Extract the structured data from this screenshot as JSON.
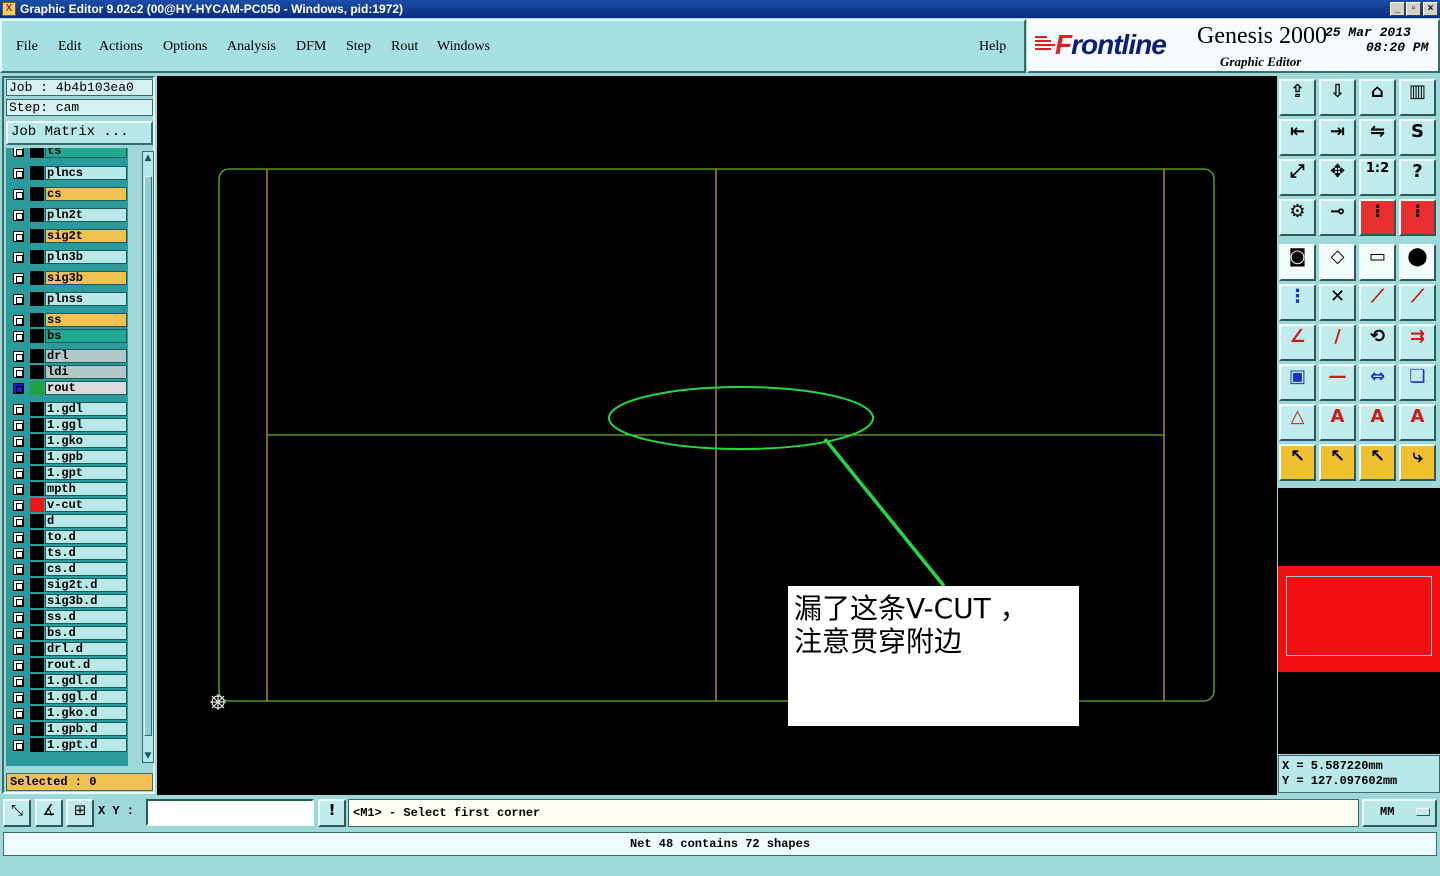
{
  "window": {
    "title": "Graphic Editor 9.02c2 (00@HY-HYCAM-PC050 - Windows, pid:1972)",
    "app_icon_label": "X",
    "controls": {
      "minimize": "_",
      "restore": "▫",
      "close": "×"
    }
  },
  "menu": {
    "items": [
      "File",
      "Edit",
      "Actions",
      "Options",
      "Analysis",
      "DFM",
      "Step",
      "Rout",
      "Windows"
    ],
    "help": "Help"
  },
  "logo": {
    "brand_initial": "F",
    "brand_rest": "rontline",
    "product": "Genesis 2000",
    "subtitle": "Graphic Editor",
    "date": "25 Mar 2013",
    "time": "08:20 PM"
  },
  "job": {
    "job_label": "Job : 4b4b103ea0",
    "step_label": "Step: cam",
    "job_matrix_button": "Job Matrix ...",
    "selected_label": "Selected : 0"
  },
  "layers": [
    {
      "name": "ts",
      "bg": "#20a890",
      "swatch": "#000000"
    },
    {
      "name": "plncs",
      "bg": "#b8e8e8",
      "swatch": "#000000"
    },
    {
      "name": "cs",
      "bg": "#f0c050",
      "swatch": "#000000"
    },
    {
      "name": "pln2t",
      "bg": "#b8e8e8",
      "swatch": "#000000"
    },
    {
      "name": "sig2t",
      "bg": "#f0c050",
      "swatch": "#000000"
    },
    {
      "name": "pln3b",
      "bg": "#b8e8e8",
      "swatch": "#000000"
    },
    {
      "name": "sig3b",
      "bg": "#f0c050",
      "swatch": "#000000"
    },
    {
      "name": "plnss",
      "bg": "#b8e8e8",
      "swatch": "#000000"
    },
    {
      "name": "ss",
      "bg": "#f0c050",
      "swatch": "#000000"
    },
    {
      "name": "bs",
      "bg": "#20a890",
      "swatch": "#000000"
    },
    {
      "name": "drl",
      "bg": "#b0c8c8",
      "swatch": "#000000"
    },
    {
      "name": "ldi",
      "bg": "#b0c8c8",
      "swatch": "#000000"
    },
    {
      "name": "rout",
      "bg": "#dcdcdc",
      "swatch": "#20a040",
      "active": true
    },
    {
      "name": "1.gdl",
      "bg": "#b8e8e8",
      "swatch": "#000000"
    },
    {
      "name": "1.ggl",
      "bg": "#b8e8e8",
      "swatch": "#000000"
    },
    {
      "name": "1.gko",
      "bg": "#b8e8e8",
      "swatch": "#000000"
    },
    {
      "name": "1.gpb",
      "bg": "#b8e8e8",
      "swatch": "#000000"
    },
    {
      "name": "1.gpt",
      "bg": "#b8e8e8",
      "swatch": "#000000"
    },
    {
      "name": "mpth",
      "bg": "#b8e8e8",
      "swatch": "#000000"
    },
    {
      "name": "v-cut",
      "bg": "#b8e8e8",
      "swatch": "#e81818"
    },
    {
      "name": "d",
      "bg": "#b8e8e8",
      "swatch": "#000000"
    },
    {
      "name": "to.d",
      "bg": "#b8e8e8",
      "swatch": "#000000"
    },
    {
      "name": "ts.d",
      "bg": "#b8e8e8",
      "swatch": "#000000"
    },
    {
      "name": "cs.d",
      "bg": "#b8e8e8",
      "swatch": "#000000"
    },
    {
      "name": "sig2t.d",
      "bg": "#b8e8e8",
      "swatch": "#000000"
    },
    {
      "name": "sig3b.d",
      "bg": "#b8e8e8",
      "swatch": "#000000"
    },
    {
      "name": "ss.d",
      "bg": "#b8e8e8",
      "swatch": "#000000"
    },
    {
      "name": "bs.d",
      "bg": "#b8e8e8",
      "swatch": "#000000"
    },
    {
      "name": "drl.d",
      "bg": "#b8e8e8",
      "swatch": "#000000"
    },
    {
      "name": "rout.d",
      "bg": "#b8e8e8",
      "swatch": "#000000"
    },
    {
      "name": "1.gdl.d",
      "bg": "#b8e8e8",
      "swatch": "#000000"
    },
    {
      "name": "1.ggl.d",
      "bg": "#b8e8e8",
      "swatch": "#000000"
    },
    {
      "name": "1.gko.d",
      "bg": "#b8e8e8",
      "swatch": "#000000"
    },
    {
      "name": "1.gpb.d",
      "bg": "#b8e8e8",
      "swatch": "#000000"
    },
    {
      "name": "1.gpt.d",
      "bg": "#b8e8e8",
      "swatch": "#000000"
    }
  ],
  "annotation": {
    "line1": "漏了这条V-CUT ，",
    "line2": "注意贯穿附边"
  },
  "toolbar": [
    {
      "name": "open-job-icon",
      "glyph": "⇪"
    },
    {
      "name": "save-icon",
      "glyph": "⇩"
    },
    {
      "name": "home-icon",
      "glyph": "⌂"
    },
    {
      "name": "window-split-icon",
      "glyph": "▥"
    },
    {
      "name": "import-icon",
      "glyph": "⇤"
    },
    {
      "name": "export-icon",
      "glyph": "⇥"
    },
    {
      "name": "mirror-icon",
      "glyph": "⇋"
    },
    {
      "name": "s-curve-icon",
      "glyph": "S"
    },
    {
      "name": "zoom-fit-icon",
      "glyph": "⤢"
    },
    {
      "name": "pan-icon",
      "glyph": "✥"
    },
    {
      "name": "scale-1-2-icon",
      "glyph": "1:2"
    },
    {
      "name": "help-icon",
      "glyph": "?"
    },
    {
      "name": "tools-icon",
      "glyph": "⚙"
    },
    {
      "name": "probe-icon",
      "glyph": "⊸"
    },
    {
      "name": "netlist-icon",
      "glyph": "⁝",
      "state": "sel"
    },
    {
      "name": "netlist-compare-icon",
      "glyph": "⁝",
      "state": "sel"
    },
    {
      "name": "snap-pad-icon",
      "glyph": "◙",
      "state": "wht"
    },
    {
      "name": "draw-shape-icon",
      "glyph": "◇",
      "state": "wht"
    },
    {
      "name": "ruler-icon",
      "glyph": "▭",
      "state": "wht"
    },
    {
      "name": "select-box-icon",
      "glyph": "⬤",
      "state": "wht"
    },
    {
      "name": "nodes-icon",
      "glyph": "⋮",
      "color": "blue"
    },
    {
      "name": "cross-icon",
      "glyph": "✕"
    },
    {
      "name": "line-point-icon",
      "glyph": "⟋",
      "color": "red"
    },
    {
      "name": "line-end-icon",
      "glyph": "⟋",
      "color": "red"
    },
    {
      "name": "angle-icon",
      "glyph": "∠",
      "color": "red"
    },
    {
      "name": "slash-icon",
      "glyph": "/",
      "color": "red"
    },
    {
      "name": "arc-icon",
      "glyph": "⟲"
    },
    {
      "name": "flip-icon",
      "glyph": "⇉",
      "color": "red"
    },
    {
      "name": "square-point-icon",
      "glyph": "▣",
      "color": "blue"
    },
    {
      "name": "horizontal-line-icon",
      "glyph": "—",
      "color": "red"
    },
    {
      "name": "measure-icon",
      "glyph": "⇔",
      "color": "blue"
    },
    {
      "name": "shapes-icon",
      "glyph": "❏",
      "color": "blue"
    },
    {
      "name": "triangle-icon",
      "glyph": "△",
      "color": "red"
    },
    {
      "name": "triangle-a-icon",
      "glyph": "A",
      "color": "red"
    },
    {
      "name": "triangle-b-icon",
      "glyph": "A",
      "color": "red"
    },
    {
      "name": "triangle-c-icon",
      "glyph": "A",
      "color": "red"
    },
    {
      "name": "pointer-icon",
      "glyph": "↖",
      "state": "ylw"
    },
    {
      "name": "pointer-select-icon",
      "glyph": "↖",
      "state": "ylw"
    },
    {
      "name": "pointer-box-icon",
      "glyph": "↖",
      "state": "ylw"
    },
    {
      "name": "pointer-path-icon",
      "glyph": "⤷",
      "state": "ylw"
    }
  ],
  "coords": {
    "x": "X  =  5.587220mm",
    "y": "Y  =  127.097602mm"
  },
  "bottom": {
    "xy_label": "X Y :",
    "xy_value": "",
    "prompt_icon": "!",
    "prompt": "<M1> - Select first corner",
    "units": "MM",
    "status": "Net 48 contains 72 shapes"
  }
}
